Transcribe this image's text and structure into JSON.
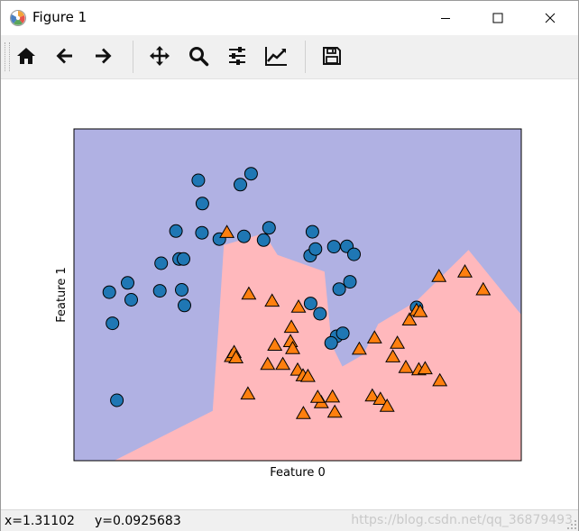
{
  "window": {
    "title": "Figure 1",
    "controls": {
      "minimize_icon": "minimize-icon",
      "maximize_icon": "maximize-icon",
      "close_icon": "close-icon"
    }
  },
  "toolbar": {
    "buttons": [
      {
        "id": "home",
        "icon": "home-icon"
      },
      {
        "id": "back",
        "icon": "back-arrow-icon"
      },
      {
        "id": "forward",
        "icon": "forward-arrow-icon"
      },
      {
        "id": "pan",
        "icon": "move-icon"
      },
      {
        "id": "zoom",
        "icon": "zoom-icon"
      },
      {
        "id": "subplots",
        "icon": "sliders-icon"
      },
      {
        "id": "edit",
        "icon": "axes-edit-icon"
      },
      {
        "id": "save",
        "icon": "save-icon"
      }
    ]
  },
  "status": {
    "x_text": "x=1.31102",
    "y_text": "y=0.0925683",
    "watermark": "https://blog.csdn.net/qq_36879493"
  },
  "chart_data": {
    "type": "scatter",
    "xlabel": "Feature 0",
    "ylabel": "Feature 1",
    "xlim": [
      0,
      100
    ],
    "ylim": [
      0,
      100
    ],
    "grid": false,
    "colors": {
      "class0_region": "#b0b1e3",
      "class1_region": "#ffb8bc",
      "class0_marker": "#1f77b4",
      "class1_marker": "#ff7f0e"
    },
    "decision_boundary": [
      [
        9,
        0
      ],
      [
        31,
        15
      ],
      [
        32.3,
        40
      ],
      [
        33.5,
        65
      ],
      [
        42.5,
        68.5
      ],
      [
        45.5,
        62
      ],
      [
        56,
        57
      ],
      [
        57.6,
        35
      ],
      [
        60,
        28.4
      ],
      [
        64.7,
        32
      ],
      [
        68,
        41.2
      ],
      [
        76.5,
        48
      ],
      [
        88.2,
        63.5
      ],
      [
        100,
        44
      ],
      [
        100,
        0
      ]
    ],
    "series": [
      {
        "marker": "circle",
        "points": [
          [
            27.8,
            84.5
          ],
          [
            28.7,
            77.5
          ],
          [
            37.2,
            83.2
          ],
          [
            39.6,
            86.5
          ],
          [
            22.8,
            69.2
          ],
          [
            28.6,
            68.7
          ],
          [
            23.5,
            60.8
          ],
          [
            24.5,
            60.8
          ],
          [
            19.5,
            59.5
          ],
          [
            12.0,
            53.6
          ],
          [
            7.9,
            50.8
          ],
          [
            12.8,
            48.5
          ],
          [
            8.6,
            41.4
          ],
          [
            24.1,
            51.5
          ],
          [
            24.7,
            46.8
          ],
          [
            19.2,
            51.2
          ],
          [
            9.6,
            18.2
          ],
          [
            32.5,
            66.8
          ],
          [
            38.0,
            67.6
          ],
          [
            42.4,
            66.5
          ],
          [
            43.6,
            70.2
          ],
          [
            53.3,
            69.0
          ],
          [
            52.8,
            61.8
          ],
          [
            54.0,
            63.8
          ],
          [
            58.1,
            64.5
          ],
          [
            61.0,
            64.6
          ],
          [
            62.6,
            62.2
          ],
          [
            61.7,
            53.9
          ],
          [
            59.3,
            51.7
          ],
          [
            52.9,
            47.4
          ],
          [
            55.0,
            44.3
          ],
          [
            58.7,
            37.5
          ],
          [
            60.1,
            38.4
          ],
          [
            57.5,
            35.5
          ],
          [
            76.6,
            46.2
          ]
        ]
      },
      {
        "marker": "triangle",
        "points": [
          [
            34.2,
            68.7
          ],
          [
            39.1,
            50.1
          ],
          [
            44.3,
            48.0
          ],
          [
            50.2,
            46.2
          ],
          [
            48.6,
            40.1
          ],
          [
            48.4,
            35.8
          ],
          [
            48.9,
            33.7
          ],
          [
            44.9,
            34.7
          ],
          [
            35.2,
            31.3
          ],
          [
            35.8,
            32.5
          ],
          [
            36.2,
            30.9
          ],
          [
            43.3,
            28.9
          ],
          [
            46.7,
            28.9
          ],
          [
            50.0,
            27.2
          ],
          [
            51.2,
            25.5
          ],
          [
            52.3,
            25.3
          ],
          [
            38.9,
            20.0
          ],
          [
            51.3,
            14.1
          ],
          [
            55.3,
            17.4
          ],
          [
            54.5,
            19.0
          ],
          [
            57.8,
            19.1
          ],
          [
            58.3,
            14.5
          ],
          [
            66.7,
            19.4
          ],
          [
            68.5,
            18.4
          ],
          [
            70.0,
            16.3
          ],
          [
            63.8,
            33.5
          ],
          [
            67.2,
            36.9
          ],
          [
            72.3,
            35.3
          ],
          [
            71.3,
            31.2
          ],
          [
            74.2,
            28.0
          ],
          [
            77.1,
            27.3
          ],
          [
            78.5,
            27.6
          ],
          [
            75.0,
            42.3
          ],
          [
            76.6,
            45.2
          ],
          [
            77.4,
            44.8
          ],
          [
            81.8,
            24.0
          ],
          [
            81.6,
            55.4
          ],
          [
            87.4,
            56.8
          ],
          [
            91.5,
            51.4
          ]
        ]
      }
    ]
  }
}
